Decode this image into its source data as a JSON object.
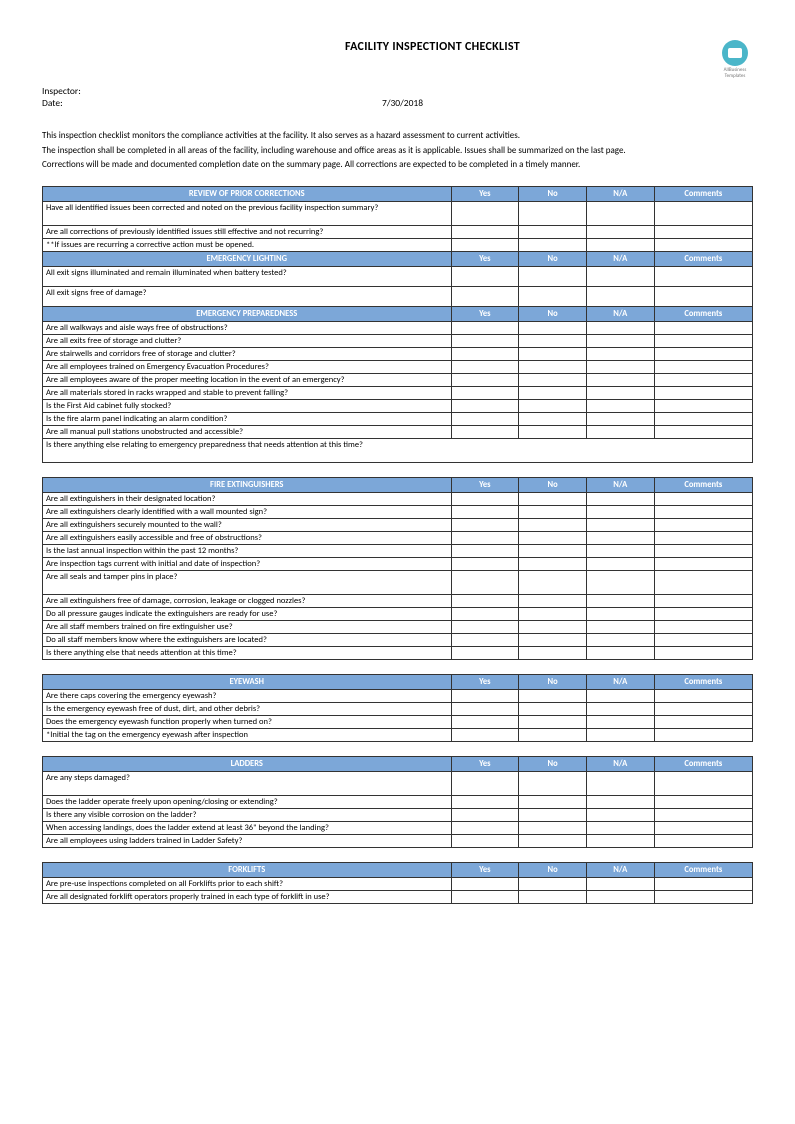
{
  "title": "FACILITY INSPECTIONT CHECKLIST",
  "meta": {
    "inspector_label": "Inspector:",
    "date_label": "Date:",
    "date_value": "7/30/2018"
  },
  "logo": {
    "line1": "AllBusiness",
    "line2": "Templates"
  },
  "intro": {
    "p1": "This inspection checklist monitors the compliance activities at the facility.  It also serves as a hazard assessment to current activities.",
    "p2": " The inspection shall be completed in all areas of the facility, including warehouse and office areas as it is applicable.  Issues shall be summarized on the last page.",
    "p3": "Corrections will be made and documented completion date on the summary page.  All corrections are expected to be completed in a timely manner."
  },
  "cols": {
    "yes": "Yes",
    "no": "No",
    "na": "N/A",
    "comments": "Comments"
  },
  "sections": [
    {
      "title": "REVIEW OF PRIOR CORRECTIONS",
      "rows": [
        {
          "q": "Have all identified issues been corrected and noted on the previous facility inspection summary?",
          "h": "tall"
        },
        {
          "q": "Are all corrections of previously identified issues still effective and not recurring?"
        },
        {
          "q": "**If issues are recurring a corrective action must be opened."
        }
      ]
    },
    {
      "title": "EMERGENCY LIGHTING",
      "rows": [
        {
          "q": "All exit signs illuminated and remain illuminated when battery tested?",
          "h": "med"
        },
        {
          "q": "All exit signs free of damage?",
          "h": "med"
        }
      ],
      "chain": true
    },
    {
      "title": "EMERGENCY PREPAREDNESS",
      "rows": [
        {
          "q": "Are all walkways and aisle ways free of obstructions?"
        },
        {
          "q": "Are all exits free of storage and clutter?"
        },
        {
          "q": "Are stairwells and corridors free of storage and clutter?"
        },
        {
          "q": "Are all employees trained on Emergency Evacuation Procedures?"
        },
        {
          "q": "Are all employees aware of the proper meeting location in the event of an emergency?"
        },
        {
          "q": "Are all materials stored in racks wrapped and stable to prevent falling?"
        },
        {
          "q": "Is the First Aid cabinet fully stocked?"
        },
        {
          "q": "Is the fire alarm panel indicating an alarm condition?"
        },
        {
          "q": "Are all manual pull stations unobstructed and accessible?"
        },
        {
          "q": "Is there anything else relating to emergency preparedness that needs attention at this time?",
          "h": "tall",
          "span": true
        }
      ],
      "chain": true
    },
    {
      "title": "FIRE EXTINGUISHERS",
      "rows": [
        {
          "q": "Are all extinguishers in their designated location?"
        },
        {
          "q": "Are all extinguishers clearly identified with a wall mounted sign?"
        },
        {
          "q": "Are all extinguishers securely mounted to the wall?"
        },
        {
          "q": "Are all extinguishers easily accessible and free of obstructions?"
        },
        {
          "q": "Is the last annual inspection within the past 12 months?"
        },
        {
          "q": "Are inspection tags current with initial and date of inspection?"
        },
        {
          "q": "Are all seals and tamper pins in place?",
          "h": "tall"
        },
        {
          "q": "Are all extinguishers free of damage, corrosion, leakage or clogged nozzles?"
        },
        {
          "q": "Do all pressure gauges indicate the extinguishers are ready for use?"
        },
        {
          "q": "Are all staff members trained on fire extinguisher use?"
        },
        {
          "q": "Do all staff members know where the extinguishers are located?"
        },
        {
          "q": "Is there anything else that needs attention at this time?"
        }
      ]
    },
    {
      "title": "EYEWASH",
      "rows": [
        {
          "q": "Are there caps covering the emergency eyewash?"
        },
        {
          "q": "Is the emergency eyewash free of dust, dirt, and other debris?"
        },
        {
          "q": "Does the emergency eyewash function properly when turned on?"
        },
        {
          "q": "*Initial the tag on the emergency eyewash after inspection"
        }
      ]
    },
    {
      "title": "LADDERS",
      "rows": [
        {
          "q": "Are any steps damaged?",
          "h": "tall"
        },
        {
          "q": "Does the ladder operate freely upon opening/closing or extending?"
        },
        {
          "q": "Is there any visible corrosion on the ladder?"
        },
        {
          "q": "When accessing landings, does the ladder extend at least 36\" beyond the landing?"
        },
        {
          "q": "Are all employees using ladders trained in Ladder Safety?"
        }
      ]
    },
    {
      "title": "FORKLIFTS",
      "rows": [
        {
          "q": "Are pre-use inspections completed on all Forklifts prior to each shift?"
        },
        {
          "q": "Are all designated forklift operators properly trained in each type of forklift in use?"
        }
      ]
    }
  ]
}
